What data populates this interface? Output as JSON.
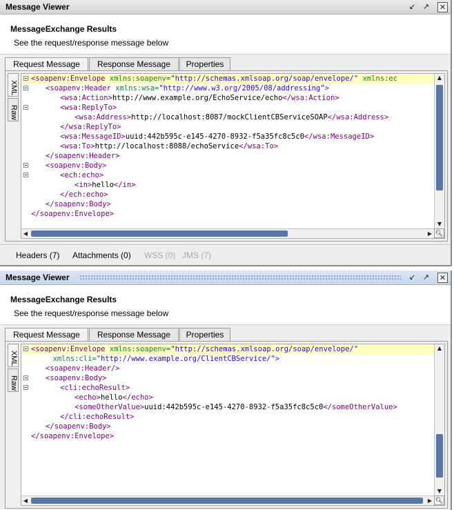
{
  "panels": [
    {
      "title": "Message Viewer",
      "header_title": "MessageExchange Results",
      "header_sub": "See the request/response message below",
      "tabs": [
        "Request Message",
        "Response Message",
        "Properties"
      ],
      "side_tabs": [
        "XML",
        "Raw"
      ],
      "lines": [
        {
          "indent": 0,
          "fold": true,
          "hl": true,
          "segs": [
            [
              "t",
              "<soapenv:Envelope "
            ],
            [
              "an",
              "xmlns:soapenv="
            ],
            [
              "v",
              "\"http://schemas.xmlsoap.org/soap/envelope/\""
            ],
            [
              "an",
              " xmlns:ec"
            ]
          ]
        },
        {
          "indent": 1,
          "fold": true,
          "segs": [
            [
              "t",
              "<soapenv:Header "
            ],
            [
              "an",
              "xmlns:wsa="
            ],
            [
              "v",
              "\"http://www.w3.org/2005/08/addressing\""
            ],
            [
              "t",
              ">"
            ]
          ]
        },
        {
          "indent": 2,
          "segs": [
            [
              "t",
              "<wsa:Action>"
            ],
            [
              "p",
              "http://www.example.org/EchoService/echo"
            ],
            [
              "t",
              "</wsa:Action>"
            ]
          ]
        },
        {
          "indent": 2,
          "fold": true,
          "segs": [
            [
              "t",
              "<wsa:ReplyTo>"
            ]
          ]
        },
        {
          "indent": 3,
          "segs": [
            [
              "t",
              "<wsa:Address>"
            ],
            [
              "p",
              "http://localhost:8087/mockClientCBServiceSOAP"
            ],
            [
              "t",
              "</wsa:Address>"
            ]
          ]
        },
        {
          "indent": 2,
          "segs": [
            [
              "t",
              "</wsa:ReplyTo>"
            ]
          ]
        },
        {
          "indent": 2,
          "segs": [
            [
              "t",
              "<wsa:MessageID>"
            ],
            [
              "p",
              "uuid:442b595c-e145-4270-8932-f5a35fc8c5c0"
            ],
            [
              "t",
              "</wsa:MessageID>"
            ]
          ]
        },
        {
          "indent": 2,
          "segs": [
            [
              "t",
              "<wsa:To>"
            ],
            [
              "p",
              "http://localhost:8088/echoService"
            ],
            [
              "t",
              "</wsa:To>"
            ]
          ]
        },
        {
          "indent": 1,
          "segs": [
            [
              "t",
              "</soapenv:Header>"
            ]
          ]
        },
        {
          "indent": 1,
          "fold": true,
          "segs": [
            [
              "t",
              "<soapenv:Body>"
            ]
          ]
        },
        {
          "indent": 2,
          "fold": true,
          "segs": [
            [
              "t",
              "<ech:echo>"
            ]
          ]
        },
        {
          "indent": 3,
          "segs": [
            [
              "t",
              "<in>"
            ],
            [
              "p",
              "hello"
            ],
            [
              "t",
              "</in>"
            ]
          ]
        },
        {
          "indent": 2,
          "segs": [
            [
              "t",
              "</ech:echo>"
            ]
          ]
        },
        {
          "indent": 1,
          "segs": [
            [
              "t",
              "</soapenv:Body>"
            ]
          ]
        },
        {
          "indent": 0,
          "segs": [
            [
              "t",
              "</soapenv:Envelope>"
            ]
          ]
        }
      ],
      "bottom_tabs": [
        {
          "label": "Headers (7)",
          "enabled": true
        },
        {
          "label": "Attachments (0)",
          "enabled": true
        },
        {
          "label": "WSS (0)",
          "enabled": false
        },
        {
          "label": "JMS (7)",
          "enabled": false
        }
      ]
    },
    {
      "title": "Message Viewer",
      "header_title": "MessageExchange Results",
      "header_sub": "See the request/response message below",
      "tabs": [
        "Request Message",
        "Response Message",
        "Properties"
      ],
      "side_tabs": [
        "XML",
        "Raw"
      ],
      "lines": [
        {
          "indent": 0,
          "fold": true,
          "hl": true,
          "segs": [
            [
              "t",
              "<soapenv:Envelope "
            ],
            [
              "an",
              "xmlns:soapenv="
            ],
            [
              "v",
              "\"http://schemas.xmlsoap.org/soap/envelope/\""
            ]
          ]
        },
        {
          "indent": 1.5,
          "segs": [
            [
              "an",
              "xmlns:cli="
            ],
            [
              "v",
              "\"http://www.example.org/ClientCBService/\""
            ],
            [
              "t",
              ">"
            ]
          ]
        },
        {
          "indent": 1,
          "segs": [
            [
              "t",
              "<soapenv:Header/>"
            ]
          ]
        },
        {
          "indent": 1,
          "fold": true,
          "segs": [
            [
              "t",
              "<soapenv:Body>"
            ]
          ]
        },
        {
          "indent": 2,
          "fold": true,
          "segs": [
            [
              "t",
              "<cli:echoResult>"
            ]
          ]
        },
        {
          "indent": 3,
          "segs": [
            [
              "t",
              "<echo>"
            ],
            [
              "p",
              "hello"
            ],
            [
              "t",
              "</echo>"
            ]
          ]
        },
        {
          "indent": 3,
          "segs": [
            [
              "t",
              "<someOtherValue>"
            ],
            [
              "p",
              "uuid:442b595c-e145-4270-8932-f5a35fc8c5c0"
            ],
            [
              "t",
              "</someOtherValue>"
            ]
          ]
        },
        {
          "indent": 2,
          "segs": [
            [
              "t",
              "</cli:echoResult>"
            ]
          ]
        },
        {
          "indent": 1,
          "segs": [
            [
              "t",
              "</soapenv:Body>"
            ]
          ]
        },
        {
          "indent": 0,
          "segs": [
            [
              "t",
              "</soapenv:Envelope>"
            ]
          ]
        }
      ]
    }
  ],
  "colors": {
    "tag": "#7a0080",
    "attr_name": "#1a7f2e",
    "attr_value": "#2a00ff",
    "highlight": "#ffffc0",
    "scroll_thumb": "#5677a8"
  }
}
